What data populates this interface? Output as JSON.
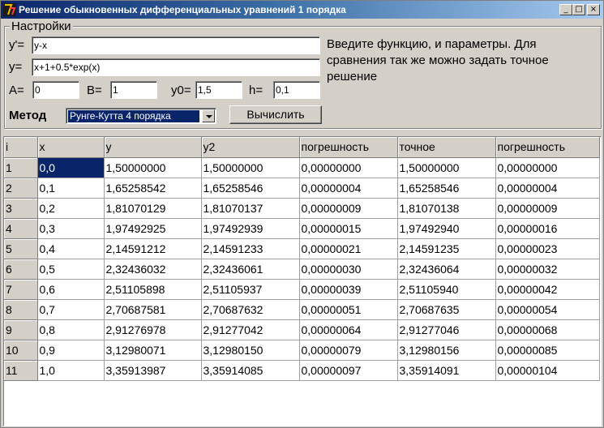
{
  "window": {
    "title": "Решение обыкновенных дифференциальных уравнений 1 порядка",
    "min_label": "_",
    "max_label": "□",
    "close_label": "×"
  },
  "settings": {
    "group_title": "Настройки",
    "yprime_label": "y'=",
    "yprime_value": "y-x",
    "y_label": "y=",
    "y_value": "x+1+0.5*exp(x)",
    "a_label": "A=",
    "a_value": "0",
    "b_label": "B=",
    "b_value": "1",
    "y0_label": "y0=",
    "y0_value": "1,5",
    "h_label": "h=",
    "h_value": "0,1",
    "description": "Введите функцию, и параметры. Для сравнения так же можно задать точное решение",
    "method_label": "Метод",
    "method_value": "Рунге-Кутта 4 порядка",
    "compute_label": "Вычислить"
  },
  "table": {
    "headers": [
      "i",
      "x",
      "y",
      "y2",
      "погрешность",
      "точное",
      "погрешность"
    ],
    "rows": [
      [
        "1",
        "0,0",
        "1,50000000",
        "1,50000000",
        "0,00000000",
        "1,50000000",
        "0,00000000"
      ],
      [
        "2",
        "0,1",
        "1,65258542",
        "1,65258546",
        "0,00000004",
        "1,65258546",
        "0,00000004"
      ],
      [
        "3",
        "0,2",
        "1,81070129",
        "1,81070137",
        "0,00000009",
        "1,81070138",
        "0,00000009"
      ],
      [
        "4",
        "0,3",
        "1,97492925",
        "1,97492939",
        "0,00000015",
        "1,97492940",
        "0,00000016"
      ],
      [
        "5",
        "0,4",
        "2,14591212",
        "2,14591233",
        "0,00000021",
        "2,14591235",
        "0,00000023"
      ],
      [
        "6",
        "0,5",
        "2,32436032",
        "2,32436061",
        "0,00000030",
        "2,32436064",
        "0,00000032"
      ],
      [
        "7",
        "0,6",
        "2,51105898",
        "2,51105937",
        "0,00000039",
        "2,51105940",
        "0,00000042"
      ],
      [
        "8",
        "0,7",
        "2,70687581",
        "2,70687632",
        "0,00000051",
        "2,70687635",
        "0,00000054"
      ],
      [
        "9",
        "0,8",
        "2,91276978",
        "2,91277042",
        "0,00000064",
        "2,91277046",
        "0,00000068"
      ],
      [
        "10",
        "0,9",
        "3,12980071",
        "3,12980150",
        "0,00000079",
        "3,12980156",
        "0,00000085"
      ],
      [
        "11",
        "1,0",
        "3,35913987",
        "3,35914085",
        "0,00000097",
        "3,35914091",
        "0,00000104"
      ]
    ]
  }
}
